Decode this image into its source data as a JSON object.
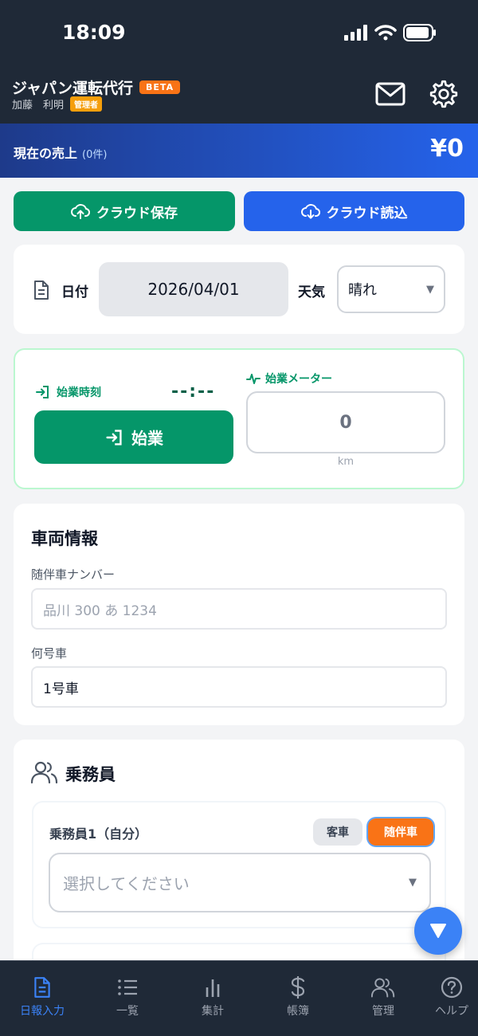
{
  "status_bar": {
    "time": "18:09"
  },
  "header": {
    "app_title": "ジャパン運転代行",
    "beta_badge": "BETA",
    "user_name": "加藤　利明",
    "role_badge": "管理者"
  },
  "sales": {
    "label": "現在の売上",
    "count": "(0件)",
    "amount": "¥0"
  },
  "cloud": {
    "save_label": "クラウド保存",
    "load_label": "クラウド読込"
  },
  "date_card": {
    "date_label": "日付",
    "date_value": "2026/04/01",
    "weather_label": "天気",
    "weather_value": "晴れ"
  },
  "start_card": {
    "start_time_label": "始業時刻",
    "start_time_value": "--:--",
    "start_button_label": "始業",
    "meter_label": "始業メーター",
    "meter_placeholder": "0",
    "meter_unit": "km"
  },
  "vehicle": {
    "title": "車両情報",
    "plate_label": "随伴車ナンバー",
    "plate_placeholder": "品川 300 あ 1234",
    "car_no_label": "何号車",
    "car_no_value": "1号車"
  },
  "crew": {
    "title": "乗務員",
    "crew1_label": "乗務員1（自分）",
    "toggle_customer": "客車",
    "toggle_escort": "随伴車",
    "select_placeholder": "選択してください"
  },
  "nav": {
    "items": [
      {
        "label": "日報入力",
        "icon": "document-icon"
      },
      {
        "label": "一覧",
        "icon": "list-icon"
      },
      {
        "label": "集計",
        "icon": "bar-chart-icon"
      },
      {
        "label": "帳簿",
        "icon": "dollar-icon"
      },
      {
        "label": "管理",
        "icon": "users-icon"
      },
      {
        "label": "ヘルプ",
        "icon": "help-icon"
      }
    ]
  },
  "colors": {
    "accent_green": "#059669",
    "accent_blue": "#2563eb",
    "accent_orange": "#f97316",
    "header_bg": "#1f2937"
  }
}
